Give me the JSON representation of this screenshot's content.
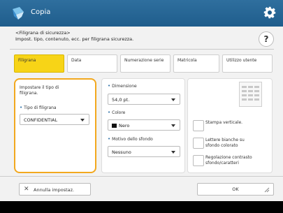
{
  "app": {
    "title": "Copia",
    "icons": {
      "app": "copy-app-icon",
      "settings": "gear-icon"
    }
  },
  "header": {
    "line1": "<Filigrana di sicurezza>",
    "line2": "Impost. tipo, contenuto, ecc. per filigrana sicurezza.",
    "help_label": "?"
  },
  "tabs": [
    {
      "label": "Filigrana",
      "active": true
    },
    {
      "label": "Data",
      "active": false
    },
    {
      "label": "Numerazione serie",
      "active": false
    },
    {
      "label": "Matricola",
      "active": false
    },
    {
      "label": "Utilizzo utente",
      "active": false
    }
  ],
  "left_panel": {
    "heading": "Impostare il tipo di filigrana.",
    "type_label": "Tipo di filigrana",
    "type_value": "CONFIDENTIAL"
  },
  "mid_panel": {
    "size_label": "Dimensione",
    "size_value": "54,0 pt.",
    "color_label": "Colore",
    "color_value": "Nero",
    "bg_label": "Motivo dello sfondo",
    "bg_value": "Nessuno"
  },
  "right_panel": {
    "options": [
      {
        "label": "Stampa verticale."
      },
      {
        "label": "Lettere bianche su sfondo colorato"
      },
      {
        "label": "Regolazione contrasto sfondo/caratteri"
      }
    ]
  },
  "footer": {
    "cancel_label": "Annulla impostaz.",
    "ok_label": "OK"
  },
  "colors": {
    "titlebar": "#1f5d8c",
    "active_tab": "#f7d417",
    "focus_outline": "#f2a81e",
    "swatch_black": "#111111"
  }
}
